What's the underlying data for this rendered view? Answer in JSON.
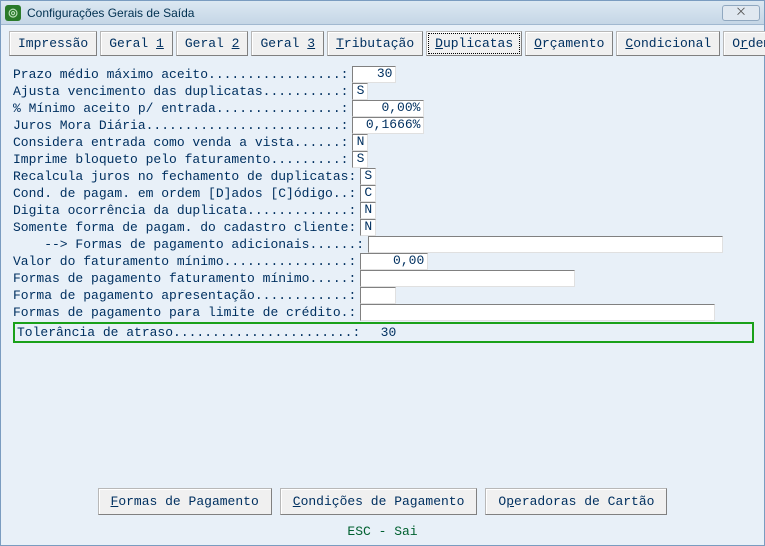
{
  "window": {
    "title": "Configurações Gerais de Saída",
    "close_glyph": "⨉"
  },
  "tabs": {
    "impressao": "Impressão",
    "geral1_pre": "Geral ",
    "geral1_u": "1",
    "geral2_pre": "Geral ",
    "geral2_u": "2",
    "geral3_pre": "Geral ",
    "geral3_u": "3",
    "tributacao_u": "T",
    "tributacao_rest": "ributação",
    "duplicatas_u": "D",
    "duplicatas_rest": "uplicatas",
    "orcamento_u": "O",
    "orcamento_rest": "rçamento",
    "condicional_u": "C",
    "condicional_rest": "ondicional",
    "ordemcred_pre": "O",
    "ordemcred_u": "r",
    "ordemcred_rest": "dem Cred."
  },
  "rows": {
    "prazo_label": "Prazo médio máximo aceito.................:",
    "prazo_value": "30",
    "ajusta_label": "Ajusta vencimento das duplicatas..........:",
    "ajusta_value": "S",
    "minimo_label": "% Mínimo aceito p/ entrada................:",
    "minimo_value": "0,00%",
    "juros_label": "Juros Mora Diária.........................:",
    "juros_value": "0,1666%",
    "considera_label": "Considera entrada como venda a vista......:",
    "considera_value": "N",
    "imprime_label": "Imprime bloqueto pelo faturamento.........:",
    "imprime_value": "S",
    "recalcula_label": "Recalcula juros no fechamento de duplicatas:",
    "recalcula_value": "S",
    "cond_label": "Cond. de pagam. em ordem [D]ados [C]ódigo..:",
    "cond_value": "C",
    "digita_label": "Digita ocorrência da duplicata.............:",
    "digita_value": "N",
    "somente_label": "Somente forma de pagam. do cadastro cliente:",
    "somente_value": "N",
    "formas_adic_label": "    --> Formas de pagamento adicionais......:",
    "formas_adic_value": "",
    "valor_fat_label": "Valor do faturamento mínimo................:",
    "valor_fat_value": "0,00",
    "formas_fat_label": "Formas de pagamento faturamento mínimo.....:",
    "formas_fat_value": "",
    "forma_apres_label": "Forma de pagamento apresentação............:",
    "forma_apres_value": "",
    "formas_lim_label": "Formas de pagamento para limite de crédito.:",
    "formas_lim_value": "",
    "tolerancia_label": "Tolerância de atraso.......................:",
    "tolerancia_value": "30"
  },
  "buttons": {
    "formas_u": "F",
    "formas_rest": "ormas de Pagamento",
    "cond_u": "C",
    "cond_rest": "ondições de Pagamento",
    "oper_pre": "O",
    "oper_u": "p",
    "oper_rest": "eradoras de Cartão"
  },
  "status": "ESC - Sai"
}
